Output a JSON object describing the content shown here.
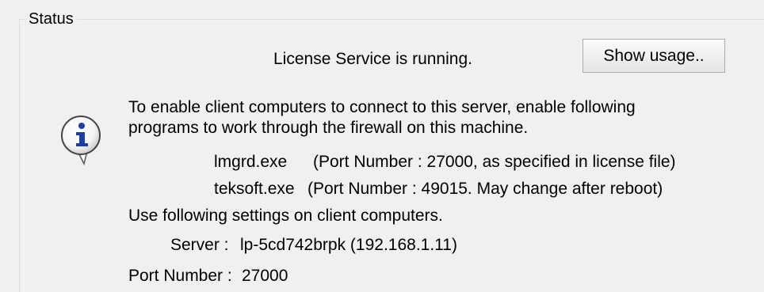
{
  "group": {
    "title": "Status"
  },
  "status": {
    "message": "License Service is running.",
    "show_usage_label": "Show usage.."
  },
  "info": {
    "icon": "info-icon",
    "line1": "To enable client computers to connect to this server, enable following",
    "line2": "programs to work through the firewall on this machine.",
    "programs": [
      {
        "name": "lmgrd.exe",
        "detail": "(Port Number : 27000, as specified in license file)"
      },
      {
        "name": "teksoft.exe",
        "detail": "(Port Number : 49015. May change after reboot)"
      }
    ]
  },
  "client": {
    "intro": "Use following settings on client computers.",
    "server_label": "Server :",
    "server_value": "lp-5cd742brpk (192.168.1.11)",
    "port_label": "Port Number :",
    "port_value": "27000"
  }
}
